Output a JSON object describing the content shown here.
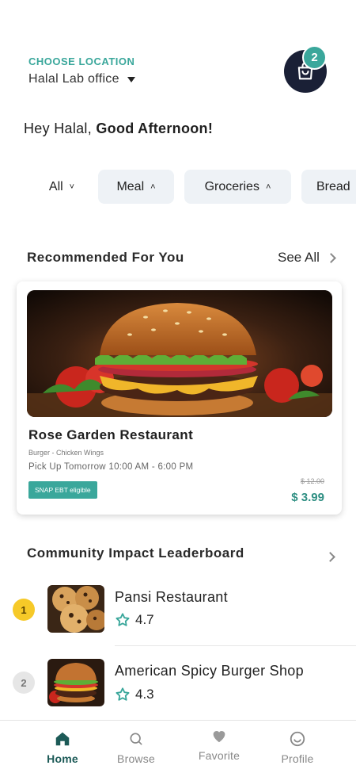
{
  "header": {
    "location_label": "CHOOSE LOCATION",
    "location_value": "Halal Lab office",
    "cart_count": "2"
  },
  "greeting": {
    "prefix": "Hey Halal, ",
    "emphasis": "Good Afternoon!"
  },
  "filters": [
    {
      "label": "All",
      "chevron": "˅"
    },
    {
      "label": "Meal",
      "chevron": "˄"
    },
    {
      "label": "Groceries",
      "chevron": "˄"
    },
    {
      "label": "Bread"
    }
  ],
  "recommended": {
    "title": "Recommended For You",
    "see_all": "See All",
    "card": {
      "name": "Rose Garden Restaurant",
      "tags": "Burger - Chicken Wings",
      "pickup": "Pick Up Tomorrow 10:00 AM - 6:00 PM",
      "badge": "SNAP EBT eligible",
      "old_price": "$ 12.00",
      "price": "$ 3.99"
    }
  },
  "leaderboard": {
    "title": "Community Impact Leaderboard",
    "items": [
      {
        "rank": "1",
        "name": "Pansi Restaurant",
        "rating": "4.7"
      },
      {
        "rank": "2",
        "name": "American Spicy Burger Shop",
        "rating": "4.3"
      }
    ]
  },
  "tabbar": {
    "tabs": [
      {
        "label": "Home",
        "icon": "home-icon"
      },
      {
        "label": "Browse",
        "icon": "search-icon"
      },
      {
        "label": "Favorite",
        "icon": "heart-icon"
      },
      {
        "label": "Profile",
        "icon": "smiley-icon"
      }
    ],
    "active": "Home"
  },
  "colors": {
    "accent": "#3aa79b",
    "price": "#2f8f83",
    "dark": "#1a2036",
    "active_tab": "#1c5a57",
    "gold": "#f6c928"
  }
}
